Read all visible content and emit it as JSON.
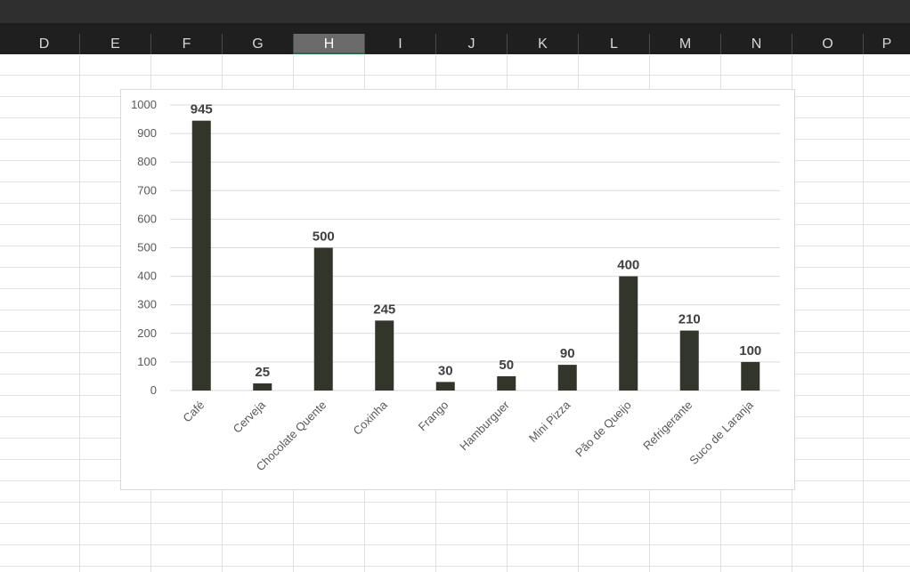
{
  "spreadsheet": {
    "columns": [
      "D",
      "E",
      "F",
      "G",
      "H",
      "I",
      "J",
      "K",
      "L",
      "M",
      "N",
      "O",
      "P"
    ],
    "selected_column": "H"
  },
  "colors": {
    "bar": "#31352a",
    "gridline": "#d9d9d9",
    "column_selected": "#6b6b6b"
  },
  "chart_data": {
    "type": "bar",
    "categories": [
      "Café",
      "Cerveja",
      "Chocolate Quente",
      "Coxinha",
      "Frango",
      "Hamburguer",
      "Mini Pizza",
      "Pão de Queijo",
      "Refrigerante",
      "Suco de Laranja"
    ],
    "values": [
      945,
      25,
      500,
      245,
      30,
      50,
      90,
      400,
      210,
      100
    ],
    "value_labels": [
      "945",
      "25",
      "500",
      "245",
      "30",
      "50",
      "90",
      "400",
      "210",
      "100"
    ],
    "y_ticks": [
      "0",
      "100",
      "200",
      "300",
      "400",
      "500",
      "600",
      "700",
      "800",
      "900",
      "1000"
    ],
    "ylim": [
      0,
      1000
    ],
    "grid": true,
    "legend": "none"
  }
}
